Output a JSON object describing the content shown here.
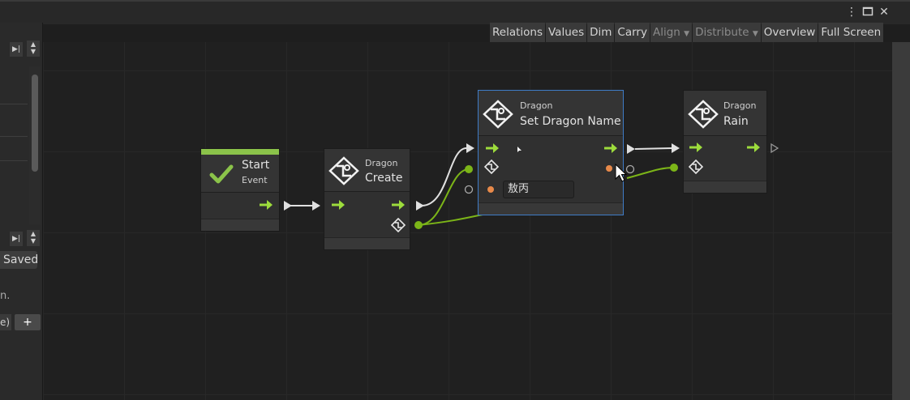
{
  "toolbar": {
    "relations": "Relations",
    "values": "Values",
    "dim": "Dim",
    "carry": "Carry",
    "align": "Align",
    "distribute": "Distribute",
    "overview": "Overview",
    "full_screen": "Full Screen"
  },
  "left_panel": {
    "saved": "Saved",
    "truncated_text": "n.",
    "paren_text": "e)",
    "plus": "+"
  },
  "nodes": {
    "start": {
      "title": "Start",
      "subtitle": "Event",
      "accent": "#8bc34a"
    },
    "create": {
      "category": "Dragon",
      "title": "Create"
    },
    "set_name": {
      "category": "Dragon",
      "title": "Set Dragon Name",
      "value": "敖丙"
    },
    "rain": {
      "category": "Dragon",
      "title": "Rain"
    }
  },
  "colors": {
    "flow_arrow": "#9ddc3c",
    "value_port": "#7cb518",
    "string_port": "#e88a4a",
    "selection": "#3f7cc7"
  }
}
